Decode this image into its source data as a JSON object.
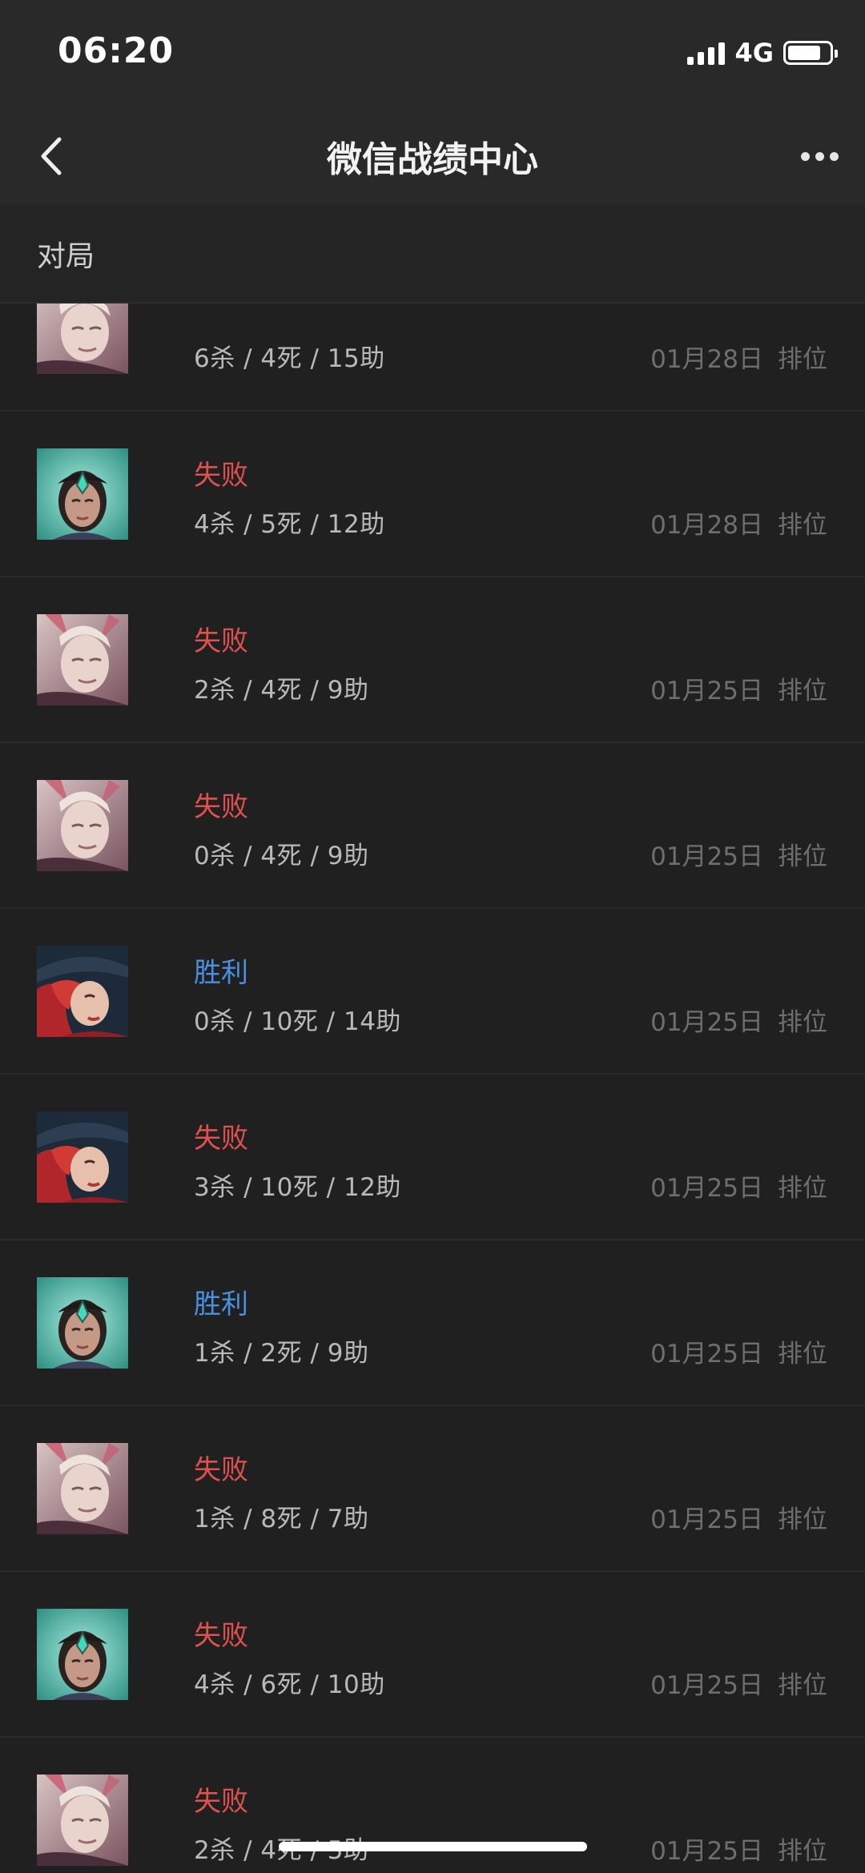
{
  "status_bar": {
    "time": "06:20",
    "network": "4G",
    "signal_bars": 4,
    "battery_level": 0.8
  },
  "nav": {
    "title": "微信战绩中心",
    "back_icon": "chevron-left-icon",
    "more_icon": "ellipsis-icon"
  },
  "section": {
    "title": "对局"
  },
  "colors": {
    "lose": "#e0504f",
    "win": "#4a90e2",
    "background": "#202020",
    "header": "#292929"
  },
  "matches": [
    {
      "hero": "rose-hero",
      "result": "",
      "kda": "6杀 / 4死 / 15助",
      "date": "01月28日",
      "mode": "排位"
    },
    {
      "hero": "green-hero",
      "result": "失败",
      "outcome": "lose",
      "kda": "4杀 / 5死 / 12助",
      "date": "01月28日",
      "mode": "排位"
    },
    {
      "hero": "rose-hero",
      "result": "失败",
      "outcome": "lose",
      "kda": "2杀 / 4死 / 9助",
      "date": "01月25日",
      "mode": "排位"
    },
    {
      "hero": "rose-hero",
      "result": "失败",
      "outcome": "lose",
      "kda": "0杀 / 4死 / 9助",
      "date": "01月25日",
      "mode": "排位"
    },
    {
      "hero": "red-hair-hero",
      "result": "胜利",
      "outcome": "win",
      "kda": "0杀 / 10死 / 14助",
      "date": "01月25日",
      "mode": "排位"
    },
    {
      "hero": "red-hair-hero",
      "result": "失败",
      "outcome": "lose",
      "kda": "3杀 / 10死 / 12助",
      "date": "01月25日",
      "mode": "排位"
    },
    {
      "hero": "green-hero",
      "result": "胜利",
      "outcome": "win",
      "kda": "1杀 / 2死 / 9助",
      "date": "01月25日",
      "mode": "排位"
    },
    {
      "hero": "rose-hero",
      "result": "失败",
      "outcome": "lose",
      "kda": "1杀 / 8死 / 7助",
      "date": "01月25日",
      "mode": "排位"
    },
    {
      "hero": "green-hero",
      "result": "失败",
      "outcome": "lose",
      "kda": "4杀 / 6死 / 10助",
      "date": "01月25日",
      "mode": "排位"
    },
    {
      "hero": "rose-hero",
      "result": "失败",
      "outcome": "lose",
      "kda": "2杀 / 4死 / 5助",
      "date": "01月25日",
      "mode": "排位"
    }
  ]
}
